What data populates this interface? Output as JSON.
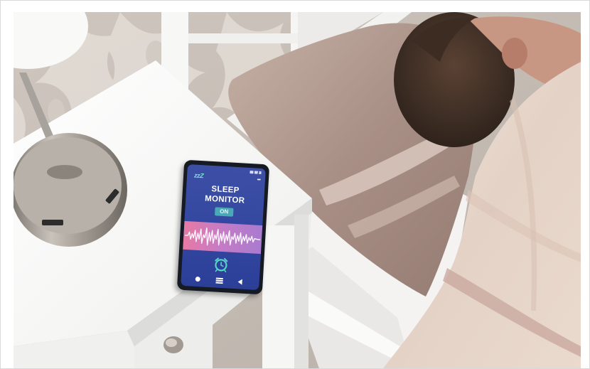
{
  "scene": {
    "subject": "person-sleeping-in-bed",
    "phone": {
      "zzz": "zzZ",
      "title_line1": "SLEEP",
      "title_line2": "MONITOR",
      "status": "ON",
      "icons": [
        "more-dots-icon",
        "sound-wave-icon",
        "alarm-clock-icon",
        "home-icon",
        "menu-icon",
        "back-icon"
      ]
    },
    "colors": {
      "phone_screen": "#3347a0",
      "status_badge": "#4aa9b6",
      "wave_gradient_start": "#e77aa5",
      "wave_gradient_end": "#a97bd0",
      "alarm_icon": "#54d5c6",
      "nightstand": "#f4f4f2",
      "pillow": "#b49d93",
      "duvet": "#e8d8cc"
    }
  }
}
